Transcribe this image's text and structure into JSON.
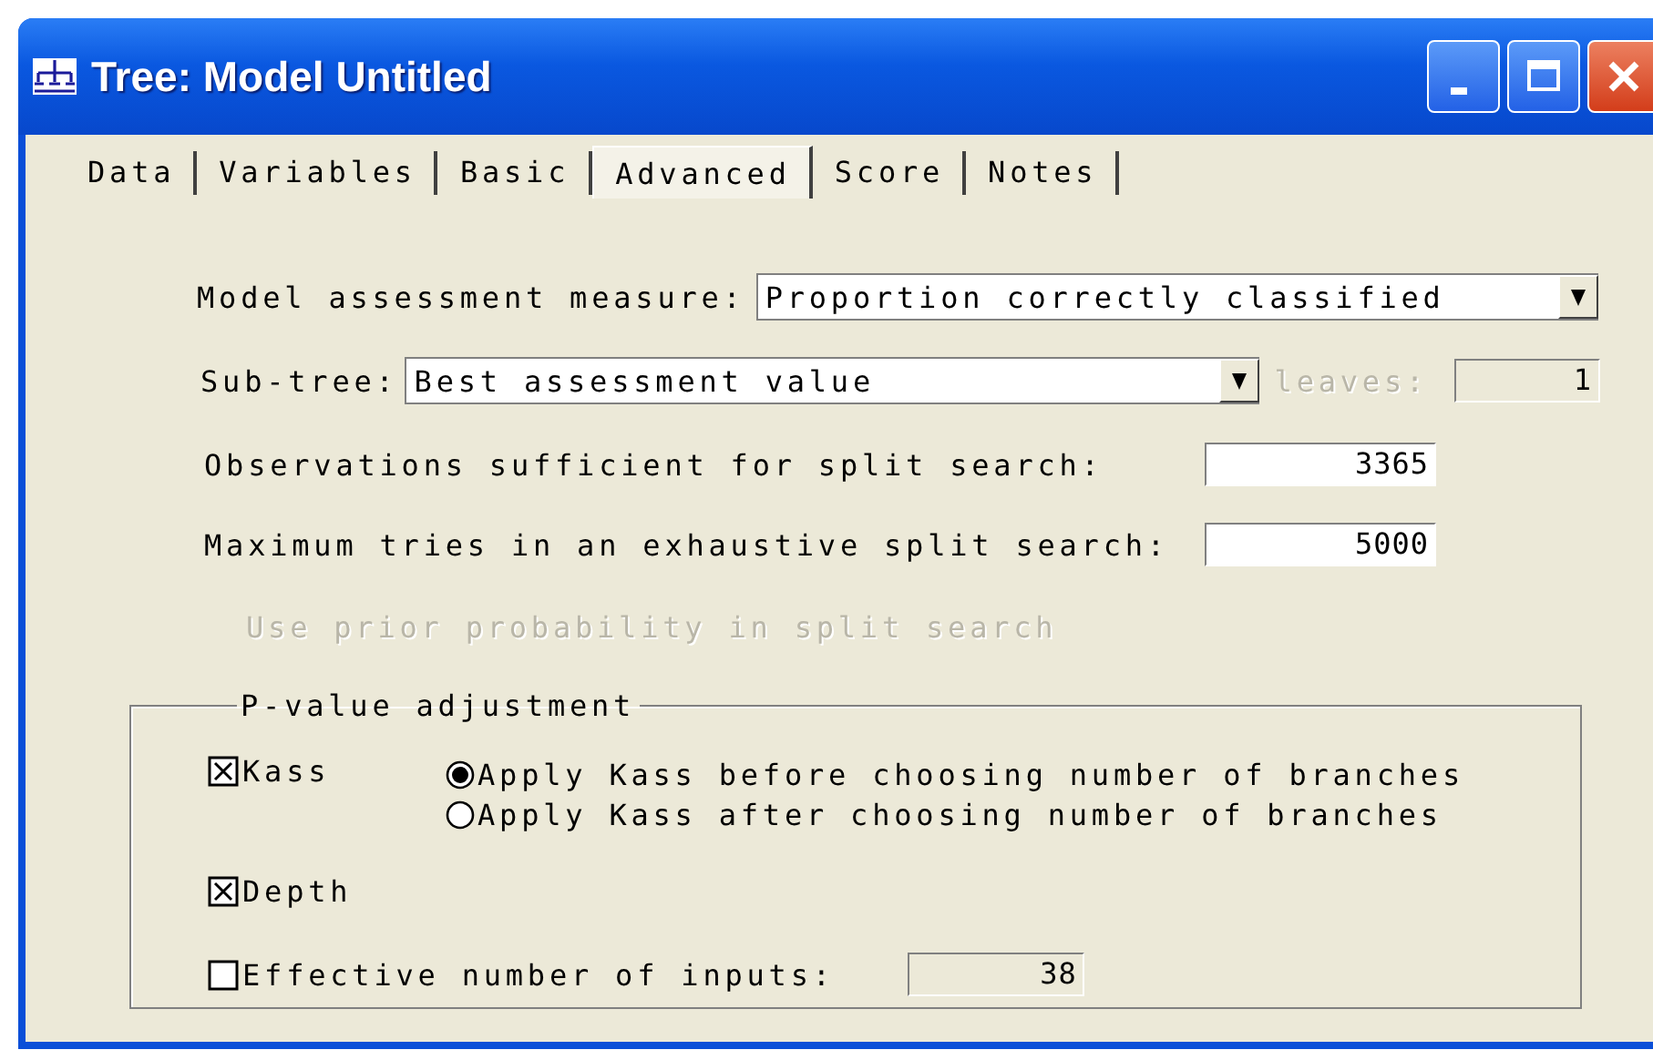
{
  "window": {
    "title": "Tree: Model Untitled"
  },
  "tabs": [
    {
      "label": "Data",
      "selected": false
    },
    {
      "label": "Variables",
      "selected": false
    },
    {
      "label": "Basic",
      "selected": false
    },
    {
      "label": "Advanced",
      "selected": true
    },
    {
      "label": "Score",
      "selected": false
    },
    {
      "label": "Notes",
      "selected": false
    }
  ],
  "assessment": {
    "label": "Model assessment measure:",
    "value": "Proportion correctly classified"
  },
  "subtree": {
    "label": "Sub-tree:",
    "value": "Best assessment value",
    "leaves_label": "leaves:",
    "leaves_value": "1",
    "leaves_disabled": true
  },
  "fields": [
    {
      "label": "Observations sufficient for split search:",
      "value": "3365"
    },
    {
      "label": "Maximum tries in an exhaustive split search:",
      "value": "5000"
    }
  ],
  "prior": {
    "label": "Use prior probability in split search",
    "disabled": true
  },
  "pvalue": {
    "title": "P-value adjustment",
    "kass": {
      "label": "Kass",
      "checked": true
    },
    "kass_options": [
      {
        "label": "Apply Kass before choosing number of branches",
        "selected": true
      },
      {
        "label": "Apply Kass after choosing number of branches",
        "selected": false
      }
    ],
    "depth": {
      "label": "Depth",
      "checked": true
    },
    "effective": {
      "label": "Effective number of inputs:",
      "checked": false,
      "value": "38",
      "disabled": true
    }
  }
}
